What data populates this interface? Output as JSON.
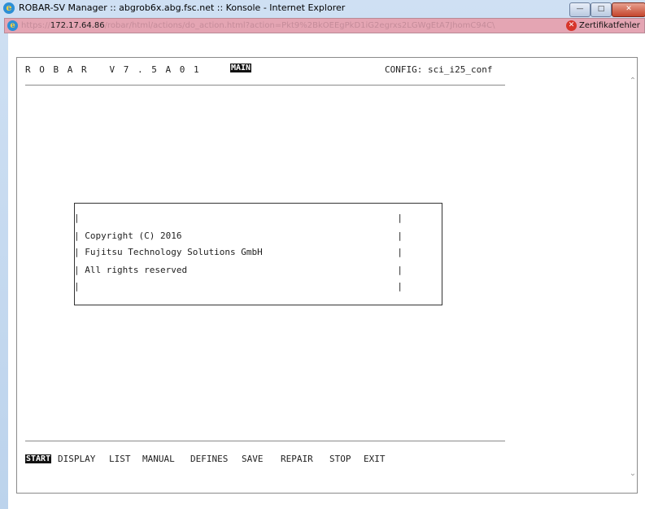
{
  "window": {
    "title": "ROBAR-SV Manager :: abgrob6x.abg.fsc.net :: Konsole - Internet Explorer",
    "controls": {
      "minimize": "—",
      "maximize": "□",
      "close": "✕"
    }
  },
  "address_bar": {
    "url_prefix": "https://",
    "url_host": "172.17.64.86",
    "url_path": "/robar/html/actions/do_action.html?action=Pkt9%2BkOEEgPkD1iG2egrxs2LGWgEtA7JhomC94C\\",
    "cert_error": "Zertifikatfehler"
  },
  "console": {
    "title": "R O B A R   V 7 . 5 A 0 1",
    "mode": "MAIN",
    "config": "CONFIG: sci_i25_conf",
    "box_lines": [
      "|                                                           |",
      "| Copyright (C) 2016                                        |",
      "| Fujitsu Technology Solutions GmbH                         |",
      "| All rights reserved                                       |",
      "|                                                           |"
    ],
    "menu": [
      {
        "label": "START",
        "active": true
      },
      {
        "label": "DISPLAY",
        "active": false
      },
      {
        "label": "LIST",
        "active": false
      },
      {
        "label": "MANUAL",
        "active": false
      },
      {
        "label": "DEFINES",
        "active": false
      },
      {
        "label": "SAVE",
        "active": false
      },
      {
        "label": "REPAIR",
        "active": false
      },
      {
        "label": "STOP",
        "active": false
      },
      {
        "label": "EXIT",
        "active": false
      }
    ]
  },
  "scrollbar": {
    "up": "⌃",
    "down": "⌄"
  }
}
